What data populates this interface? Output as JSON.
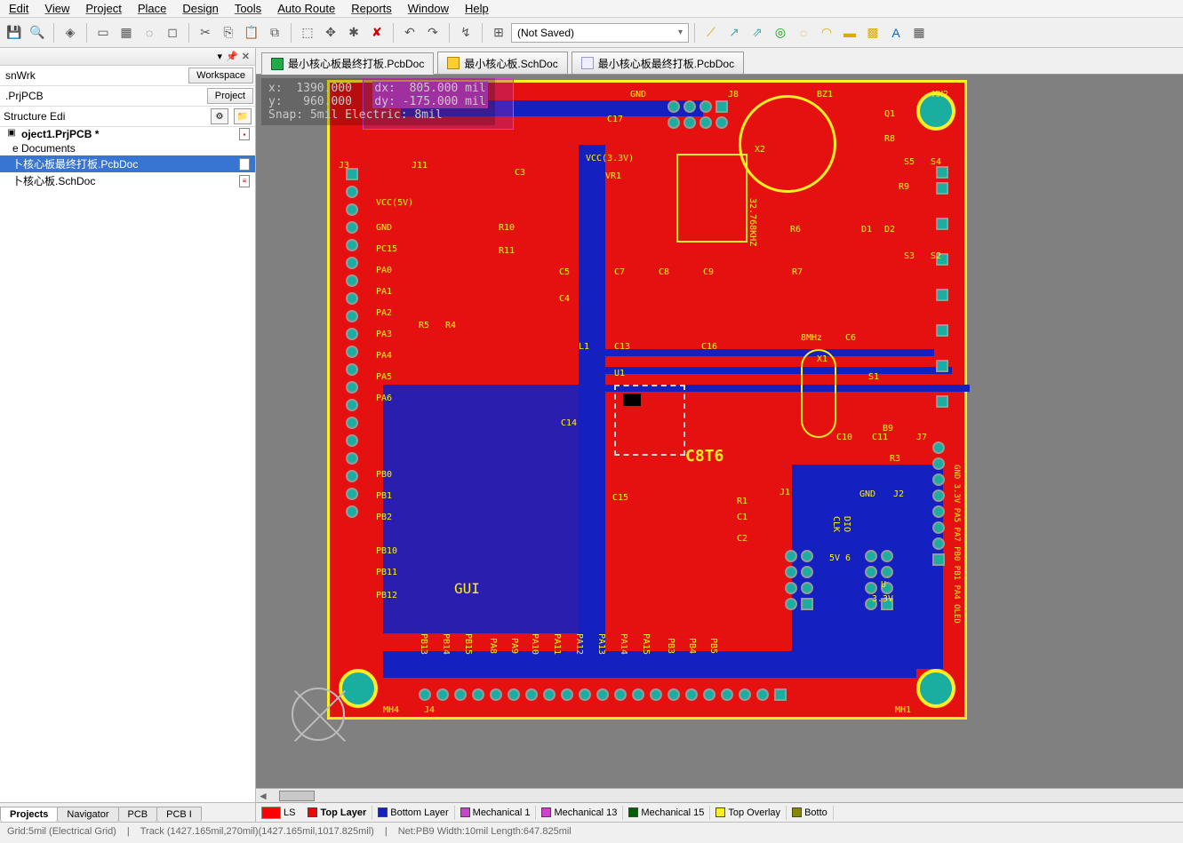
{
  "menu": [
    "Edit",
    "View",
    "Project",
    "Place",
    "Design",
    "Tools",
    "Auto Route",
    "Reports",
    "Window",
    "Help"
  ],
  "combo_value": "(Not Saved)",
  "panel": {
    "workspace_field": "snWrk",
    "workspace_btn": "Workspace",
    "project_field": ".PrjPCB",
    "project_btn": "Project",
    "structure_label": "Structure Edi"
  },
  "tree": {
    "root": "oject1.PrjPCB *",
    "folder": "e Documents",
    "doc1": "卜核心板最终打板.PcbDoc",
    "doc2": "卜核心板.SchDoc"
  },
  "bottom_panel_tabs": [
    "Projects",
    "Navigator",
    "PCB",
    "PCB I"
  ],
  "doc_tabs": [
    {
      "label": "最小核心板最终打板.PcbDoc",
      "active": true
    },
    {
      "label": "最小核心板.SchDoc",
      "active": false
    },
    {
      "label": "最小核心板最终打板.PcbDoc",
      "active": false
    }
  ],
  "hud": {
    "x_label": "x:",
    "x_val": "1390.000",
    "dx_label": "dx:",
    "dx_val": "805.000 mil",
    "y_label": "y:",
    "y_val": "960.000",
    "dy_label": "dy:",
    "dy_val": "-175.000 mil",
    "snap": "Snap: 5mil Electric: 8mil"
  },
  "pcb_silk": {
    "gnd_top": "GND",
    "j8": "J8",
    "bz1": "BZ1",
    "mh2": "MH2",
    "s4": "S4",
    "s5": "S5",
    "r8": "R8",
    "r9": "R9",
    "j3": "J3",
    "j11": "J11",
    "c3": "C3",
    "vr1": "VR1",
    "vcc33": "VCC(3.3V)",
    "c17": "C17",
    "x2": "X2",
    "khz": "32.768KHZ",
    "q1": "Q1",
    "vcc5": "VCC(5V)",
    "gnd_l": "GND",
    "r10": "R10",
    "r11": "R11",
    "r6": "R6",
    "d1": "D1",
    "d2": "D2",
    "s2": "S2",
    "s3": "S3",
    "c4": "C4",
    "c5": "C5",
    "c7": "C7",
    "c8": "C8",
    "c9": "C9",
    "r7": "R7",
    "r4": "R4",
    "r5": "R5",
    "pc15": "PC15",
    "pa0": "PA0",
    "pa1": "PA1",
    "pa2": "PA2",
    "pa3": "PA3",
    "pa4": "PA4",
    "pa5": "PA5",
    "pa6": "PA6",
    "l1": "L1",
    "c13": "C13",
    "c16": "C16",
    "mhz": "8MHz",
    "c6": "C6",
    "x1": "X1",
    "u1": "U1",
    "s1": "S1",
    "c14": "C14",
    "c8t6": "C8T6",
    "c10": "C10",
    "c11": "C11",
    "j7": "J7",
    "r3": "R3",
    "b9": "B9",
    "pb0": "PB0",
    "pb1": "PB1",
    "pb2": "PB2",
    "c15": "C15",
    "j1": "J1",
    "r1": "R1",
    "c1": "C1",
    "c2": "C2",
    "gnd_r": "GND",
    "j2": "J2",
    "clk": "CLK",
    "dio": "DIO",
    "v5": "5V",
    "v6": "6",
    "pb10": "PB10",
    "pb11": "PB11",
    "pb12": "PB12",
    "gui": "GUI",
    "v33": "3.3V",
    "u": "U",
    "pb13": "PB13",
    "pb14": "PB14",
    "pb15": "PB15",
    "pa8": "PA8",
    "pa9": "PA9",
    "pa10": "PA10",
    "pa11": "PA11",
    "pa12": "PA12",
    "pa13": "PA13",
    "pa14": "PA14",
    "pa15": "PA15",
    "pb3": "PB3",
    "pb4": "PB4",
    "pb5": "PB5",
    "mh4": "MH4",
    "j4": "J4",
    "mh1": "MH1",
    "j7side": "GND 3.3V PA5 PA7 PB0 PB1 PA4 OLED"
  },
  "layers": {
    "ls": "LS",
    "tabs": [
      {
        "name": "Top Layer",
        "color": "#ff0000",
        "active": true
      },
      {
        "name": "Bottom Layer",
        "color": "#1420c0"
      },
      {
        "name": "Mechanical 1",
        "color": "#d040d0"
      },
      {
        "name": "Mechanical 13",
        "color": "#d040d0"
      },
      {
        "name": "Mechanical 15",
        "color": "#006000"
      },
      {
        "name": "Top Overlay",
        "color": "#ffee22"
      },
      {
        "name": "Botto",
        "color": "#888800"
      }
    ]
  },
  "status": {
    "grid": "Grid:5mil   (Electrical Grid)",
    "track": "Track (1427.165mil,270mil)(1427.165mil,1017.825mil)",
    "net": "Net:PB9  Width:10mil  Length:647.825mil"
  }
}
